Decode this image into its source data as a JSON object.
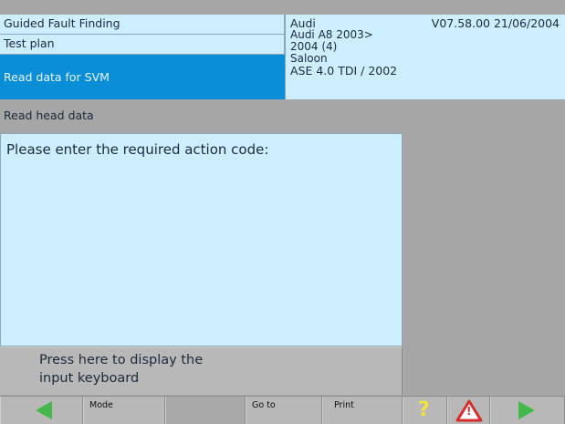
{
  "header": {
    "guided_fault_finding": "Guided Fault Finding",
    "test_plan": "Test plan",
    "selected_item": "Read data for SVM",
    "vehicle": {
      "make": "Audi",
      "version": "V07.58.00 21/06/2004",
      "model": "Audi A8 2003>",
      "year": "2004 (4)",
      "body": "Saloon",
      "engine": "ASE 4.0 TDI / 2002"
    }
  },
  "section": {
    "title": "Read head data"
  },
  "main": {
    "prompt": "Please enter the required action code:",
    "keyboard_button_line1": "Press here to display the",
    "keyboard_button_line2": "input keyboard"
  },
  "toolbar": {
    "mode_label": "Mode",
    "goto_label": "Go to",
    "print_label": "Print",
    "help_glyph": "?",
    "warning_glyph": "!"
  },
  "colors": {
    "highlight": "#0a8ed8",
    "panel": "#cdeeff",
    "toolbar": "#b8b8b8",
    "arrow_green": "#44b84a",
    "help_yellow": "#f2e23a",
    "warning_red": "#d62d2d"
  },
  "icons": [
    "back-arrow-icon",
    "help-icon",
    "warning-icon",
    "forward-arrow-icon"
  ]
}
